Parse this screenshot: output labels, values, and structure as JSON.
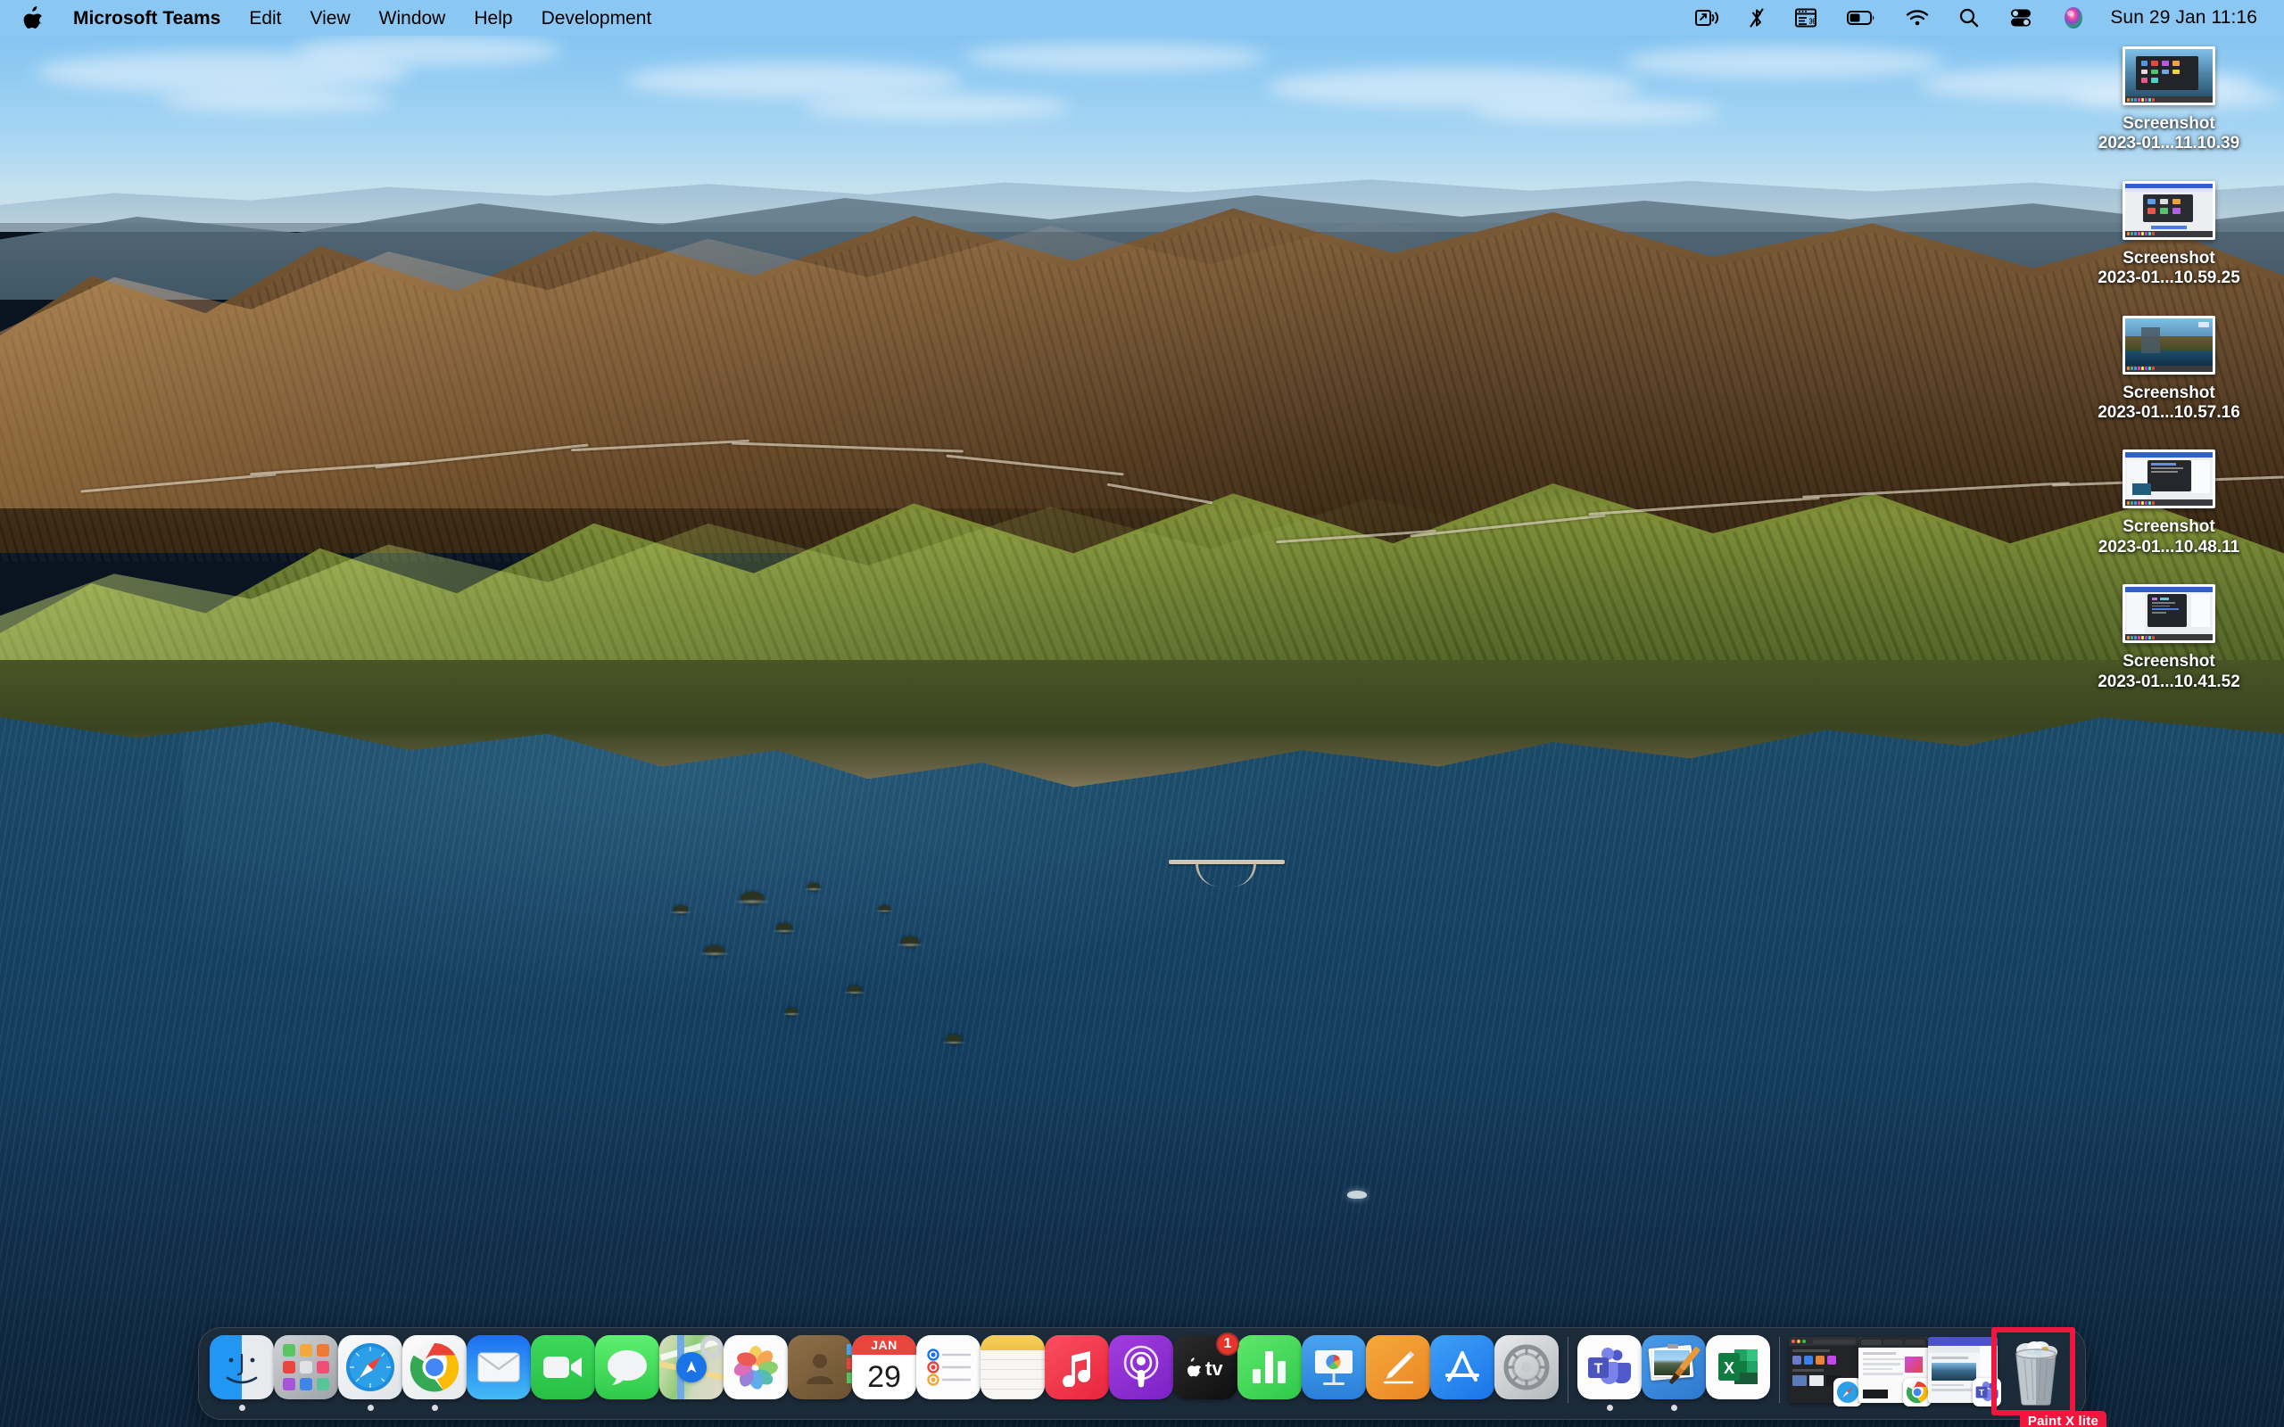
{
  "menubar": {
    "apple_icon": "apple-logo-icon",
    "items": [
      {
        "label": "Microsoft Teams",
        "bold": true
      },
      {
        "label": "Edit",
        "bold": false
      },
      {
        "label": "View",
        "bold": false
      },
      {
        "label": "Window",
        "bold": false
      },
      {
        "label": "Help",
        "bold": false
      },
      {
        "label": "Development",
        "bold": false
      }
    ],
    "status_icons": [
      {
        "name": "screen-sharing-icon"
      },
      {
        "name": "bluetooth-off-icon"
      },
      {
        "name": "app-window-command-icon"
      },
      {
        "name": "battery-icon"
      },
      {
        "name": "wifi-icon"
      },
      {
        "name": "spotlight-search-icon"
      },
      {
        "name": "control-center-icon"
      },
      {
        "name": "siri-icon"
      }
    ],
    "clock": "Sun 29 Jan  11:16"
  },
  "desktop": {
    "icons": [
      {
        "name_line1": "Screenshot",
        "name_line2": "2023-01...11.10.39",
        "thumb": "launchpad-dark"
      },
      {
        "name_line1": "Screenshot",
        "name_line2": "2023-01...10.59.25",
        "thumb": "paint-launchpad"
      },
      {
        "name_line1": "Screenshot",
        "name_line2": "2023-01...10.57.16",
        "thumb": "wallpaper-shot"
      },
      {
        "name_line1": "Screenshot",
        "name_line2": "2023-01...10.48.11",
        "thumb": "code-window"
      },
      {
        "name_line1": "Screenshot",
        "name_line2": "2023-01...10.41.52",
        "thumb": "code-window2"
      }
    ]
  },
  "dock": {
    "items": [
      {
        "name": "finder",
        "label": "Finder",
        "running": true
      },
      {
        "name": "launchpad",
        "label": "Launchpad",
        "running": false
      },
      {
        "name": "safari",
        "label": "Safari",
        "running": true
      },
      {
        "name": "google-chrome",
        "label": "Google Chrome",
        "running": true
      },
      {
        "name": "mail",
        "label": "Mail",
        "running": false
      },
      {
        "name": "facetime",
        "label": "FaceTime",
        "running": false
      },
      {
        "name": "messages",
        "label": "Messages",
        "running": false
      },
      {
        "name": "maps",
        "label": "Maps",
        "running": false
      },
      {
        "name": "photos",
        "label": "Photos",
        "running": false
      },
      {
        "name": "contacts",
        "label": "Contacts",
        "running": false
      },
      {
        "name": "calendar",
        "label": "Calendar",
        "running": false,
        "month": "JAN",
        "day": "29"
      },
      {
        "name": "reminders",
        "label": "Reminders",
        "running": false
      },
      {
        "name": "notes",
        "label": "Notes",
        "running": false
      },
      {
        "name": "music",
        "label": "Music",
        "running": false
      },
      {
        "name": "podcasts",
        "label": "Podcasts",
        "running": false
      },
      {
        "name": "apple-tv",
        "label": "TV",
        "running": false,
        "badge": "1"
      },
      {
        "name": "numbers",
        "label": "Numbers",
        "running": false
      },
      {
        "name": "keynote",
        "label": "Keynote",
        "running": false
      },
      {
        "name": "pages",
        "label": "Pages",
        "running": false
      },
      {
        "name": "app-store",
        "label": "App Store",
        "running": false
      },
      {
        "name": "system-preferences",
        "label": "System Preferences",
        "running": false
      }
    ],
    "pinned_apps": [
      {
        "name": "microsoft-teams",
        "label": "Microsoft Teams",
        "running": true
      },
      {
        "name": "paint-x-lite",
        "label": "Paint X lite",
        "running": true,
        "active": true
      },
      {
        "name": "microsoft-excel",
        "label": "Microsoft Excel",
        "running": false
      }
    ],
    "minimized_windows": [
      {
        "name": "finder-window",
        "app": "safari"
      },
      {
        "name": "chrome-window",
        "app": "chrome"
      },
      {
        "name": "teams-window",
        "app": "teams"
      }
    ],
    "trash": {
      "name": "trash",
      "label": "Trash",
      "full": true
    }
  },
  "annotation": {
    "target": "trash",
    "label": "Paint X lite",
    "color": "#f0173f"
  },
  "colors": {
    "menubar_bg": "#8cc8f3",
    "dock_bg": "#202c38",
    "accent_red": "#f0173f",
    "badge_red": "#e8352c"
  }
}
